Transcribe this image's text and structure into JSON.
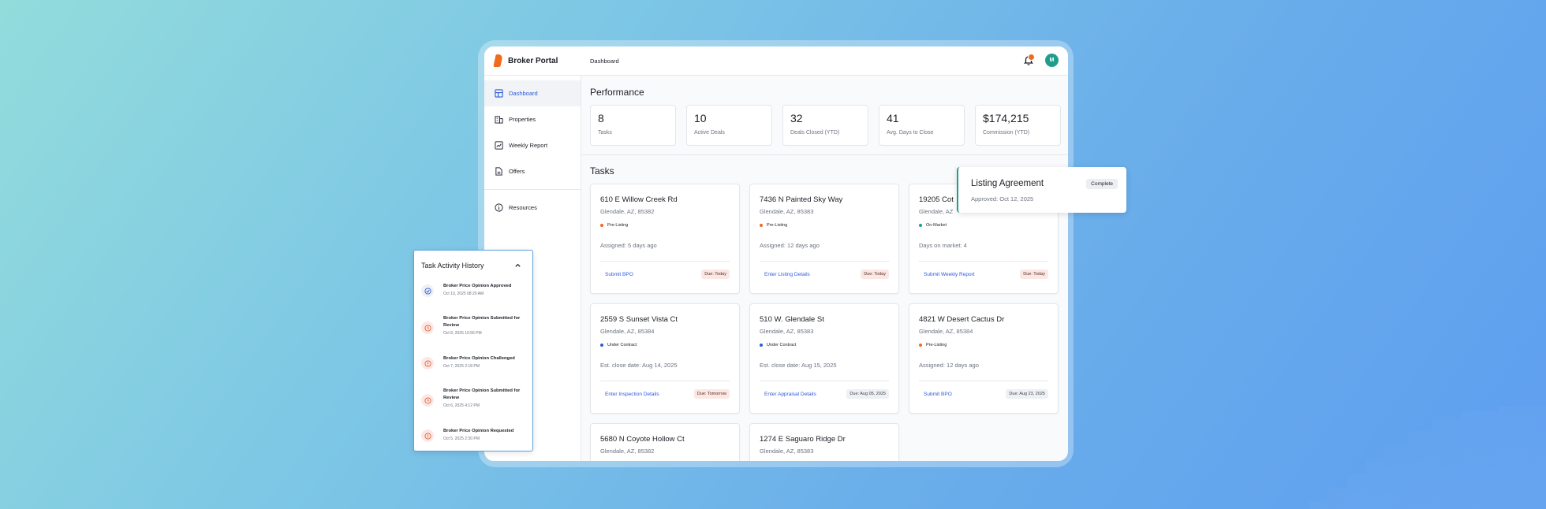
{
  "brand": {
    "name": "Broker Portal"
  },
  "sidebar": {
    "items": [
      {
        "label": "Dashboard",
        "icon": "dashboard-icon",
        "active": true
      },
      {
        "label": "Properties",
        "icon": "building-icon"
      },
      {
        "label": "Weekly Report",
        "icon": "report-icon"
      },
      {
        "label": "Offers",
        "icon": "document-icon"
      },
      {
        "label": "Resources",
        "icon": "info-icon"
      }
    ]
  },
  "topbar": {
    "breadcrumb": "Dashboard",
    "avatar_initial": "M"
  },
  "performance": {
    "title": "Performance",
    "kpis": [
      {
        "value": "8",
        "label": "Tasks"
      },
      {
        "value": "10",
        "label": "Active Deals"
      },
      {
        "value": "32",
        "label": "Deals Closed (YTD)"
      },
      {
        "value": "41",
        "label": "Avg. Days to Close"
      },
      {
        "value": "$174,215",
        "label": "Commission (YTD)"
      }
    ]
  },
  "tasks": {
    "title": "Tasks",
    "cards": [
      {
        "address": "610 E Willow Creek Rd",
        "city": "Glendale, AZ, 85382",
        "status": "Pre-Listing",
        "status_color": "#f26a1b",
        "info": "Assigned: 5 days ago",
        "action": "Submit BPO",
        "due": "Due: Today",
        "due_style": "red"
      },
      {
        "address": "7436 N Painted Sky Way",
        "city": "Glendale, AZ, 85383",
        "status": "Pre-Listing",
        "status_color": "#f26a1b",
        "info": "Assigned: 12 days ago",
        "action": "Enter Listing Details",
        "due": "Due: Today",
        "due_style": "red"
      },
      {
        "address": "19205 Cot",
        "city": "Glendale, AZ",
        "status": "On-Market",
        "status_color": "#1f9e8d",
        "info": "Days on market: 4",
        "action": "Submit Weekly Report",
        "due": "Due: Today",
        "due_style": "red"
      },
      {
        "address": "2559 S Sunset Vista Ct",
        "city": "Glendale, AZ, 85384",
        "status": "Under Contract",
        "status_color": "#2e5bd8",
        "info": "Est. close date: Aug 14, 2025",
        "action": "Enter Inspection Details",
        "due": "Due: Tomorrow",
        "due_style": "red"
      },
      {
        "address": "510 W. Glendale St",
        "city": "Glendale, AZ, 85383",
        "status": "Under Contract",
        "status_color": "#2e5bd8",
        "info": "Est. close date: Aug 15, 2025",
        "action": "Enter Appraisal Details",
        "due": "Due: Aug 05, 2025",
        "due_style": "grey"
      },
      {
        "address": "4821 W Desert Cactus Dr",
        "city": "Glendale, AZ, 85384",
        "status": "Pre-Listing",
        "status_color": "#f26a1b",
        "info": "Assigned: 12 days ago",
        "action": "Submit BPO",
        "due": "Due: Aug 23, 2025",
        "due_style": "grey"
      },
      {
        "address": "5680 N Coyote Hollow Ct",
        "city": "Glendale, AZ, 85382"
      },
      {
        "address": "1274 E Saguaro Ridge Dr",
        "city": "Glendale, AZ, 85383"
      }
    ]
  },
  "popup": {
    "title": "Listing Agreement",
    "badge": "Complete",
    "subtitle": "Approved: Oct 12, 2025"
  },
  "history": {
    "title": "Task Activity History",
    "items": [
      {
        "title": "Broker Price Opinion Approved",
        "date": "Oct 10, 2025 08:20 AM",
        "kind": "check"
      },
      {
        "title": "Broker Price Opinion Submitted for Review",
        "date": "Oct 8, 2025 10:55 PM",
        "kind": "clock"
      },
      {
        "title": "Broker Price Opinion Challenged",
        "date": "Oct 7, 2025 2:18 PM",
        "kind": "alert"
      },
      {
        "title": "Broker Price Opinion Submitted for Review",
        "date": "Oct 6, 2025 4:12 PM",
        "kind": "clock"
      },
      {
        "title": "Broker Price Opinion Requested",
        "date": "Oct 5, 2025 2:30 PM",
        "kind": "alert"
      }
    ]
  },
  "colors": {
    "accent": "#2e5bd8",
    "brand": "#f26a1b",
    "teal": "#1f9e8d"
  }
}
